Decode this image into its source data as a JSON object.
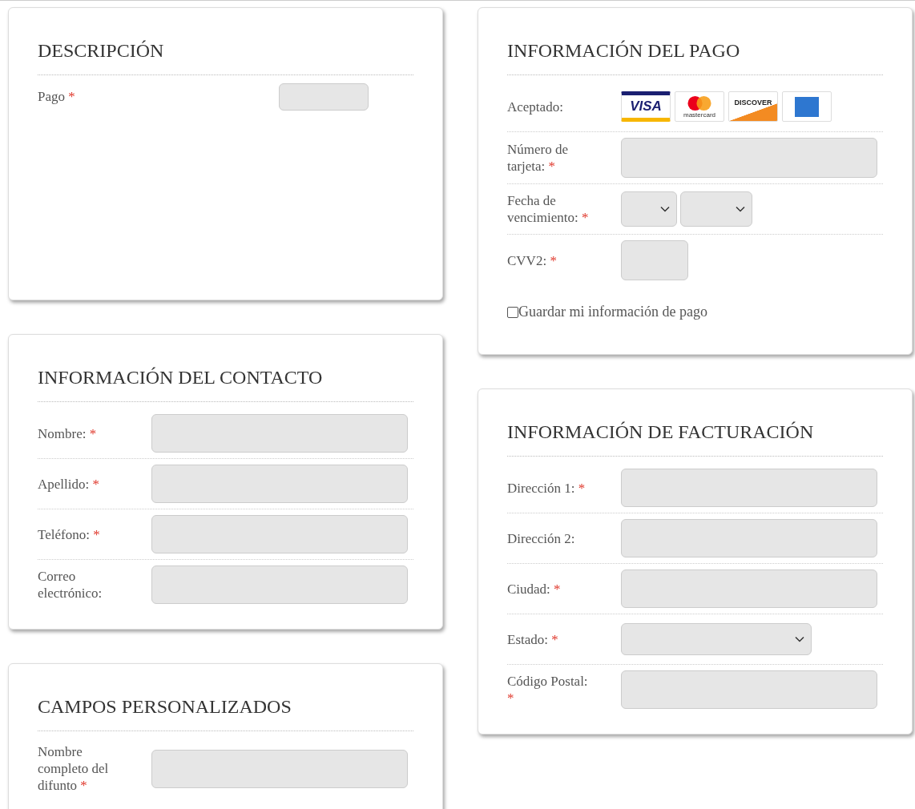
{
  "columns": [
    {
      "sections": [
        {
          "title": "DESCRIPCIÓN",
          "kind": "description",
          "fields": [
            {
              "label": "Pago",
              "required_mark": "*",
              "kind": "small_text"
            }
          ]
        },
        {
          "title": "INFORMACIÓN DEL CONTACTO",
          "kind": "form",
          "fields": [
            {
              "label": "Nombre:",
              "required_mark": "*",
              "kind": "text"
            },
            {
              "label": "Apellido:",
              "required_mark": "*",
              "kind": "text"
            },
            {
              "label": "Teléfono:",
              "required_mark": "*",
              "kind": "text"
            },
            {
              "label": "Correo electrónico:",
              "kind": "text"
            }
          ]
        },
        {
          "title": "CAMPOS PERSONALIZADOS",
          "kind": "form",
          "fields": [
            {
              "label": "Nombre completo del difunto",
              "required_mark": "*",
              "kind": "text"
            }
          ]
        }
      ]
    },
    {
      "sections": [
        {
          "title": "INFORMACIÓN DEL PAGO",
          "kind": "form",
          "fields": [
            {
              "label": "Aceptado:",
              "kind": "cards",
              "cards": [
                {
                  "kind": "visa",
                  "text": "VISA"
                },
                {
                  "kind": "mastercard",
                  "text": "mastercard"
                },
                {
                  "kind": "discover",
                  "text": "DISCOVER"
                },
                {
                  "kind": "amex"
                }
              ]
            },
            {
              "label": "Número de tarjeta:",
              "required_mark": "*",
              "kind": "tall_text"
            },
            {
              "label": "Fecha de vencimiento:",
              "required_mark": "*",
              "kind": "month_year"
            },
            {
              "label": "CVV2:",
              "required_mark": "*",
              "kind": "code"
            }
          ],
          "checkbox": {
            "label": "Guardar mi información de pago",
            "checked": false
          }
        },
        {
          "title": "INFORMACIÓN DE FACTURACIÓN",
          "kind": "form",
          "fields": [
            {
              "label": "Dirección 1:",
              "required_mark": "*",
              "kind": "text"
            },
            {
              "label": "Dirección 2:",
              "kind": "text"
            },
            {
              "label": "Ciudad:",
              "required_mark": "*",
              "kind": "text"
            },
            {
              "label": "Estado:",
              "required_mark": "*",
              "kind": "select"
            },
            {
              "label": "Código Postal:",
              "required_mark": "*",
              "kind": "text"
            }
          ]
        }
      ]
    }
  ]
}
